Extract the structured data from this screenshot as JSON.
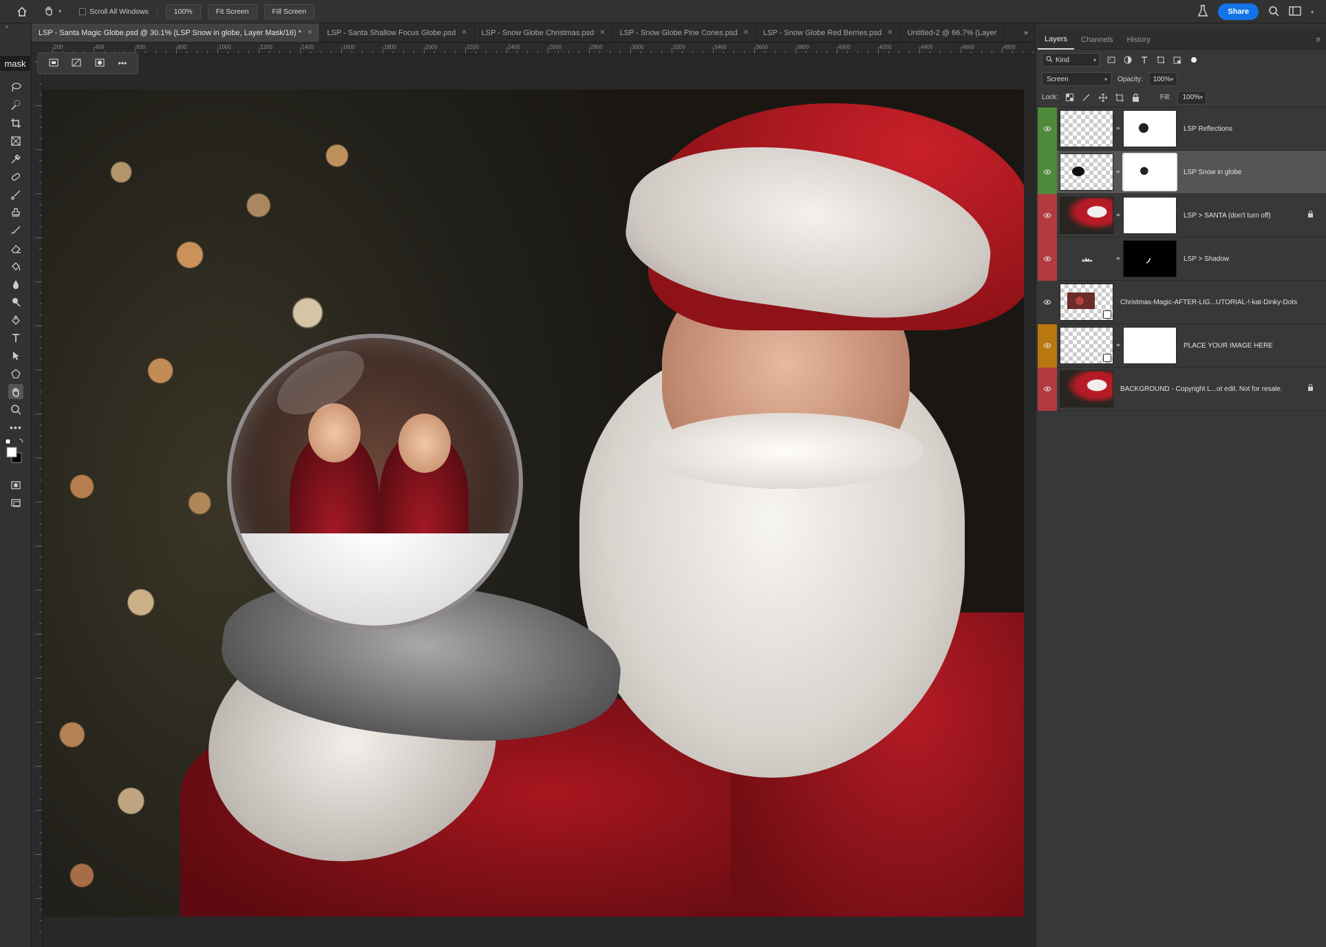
{
  "options_bar": {
    "scroll_all_windows": "Scroll All Windows",
    "zoom_value": "100%",
    "fit_screen": "Fit Screen",
    "fill_screen": "Fill Screen",
    "share": "Share"
  },
  "toolbar": {
    "mask_label": "mask"
  },
  "tabs": [
    {
      "label": "LSP - Santa Magic Globe.psd @ 30.1% (LSP Snow in globe, Layer Mask/16) *",
      "active": true
    },
    {
      "label": "LSP - Santa Shallow Focus Globe.psd",
      "active": false
    },
    {
      "label": "LSP - Snow Globe Christmas.psd",
      "active": false
    },
    {
      "label": "LSP - Snow Globe Pine Cones.psd",
      "active": false
    },
    {
      "label": "LSP - Snow Globe Red Berries.psd",
      "active": false
    },
    {
      "label": "Untitled-2 @ 66.7% (Layer",
      "active": false
    }
  ],
  "ruler_labels": [
    "200",
    "400",
    "600",
    "800",
    "1000",
    "1200",
    "1400",
    "1600",
    "1800",
    "2000",
    "2200",
    "2400",
    "2600",
    "2800",
    "3000",
    "3200",
    "3400",
    "3600",
    "3800",
    "4000",
    "4200",
    "4400",
    "4600",
    "4800"
  ],
  "panel": {
    "tabs": [
      "Layers",
      "Channels",
      "History"
    ],
    "kind_label": "Kind",
    "blend_mode": "Screen",
    "opacity_label": "Opacity:",
    "opacity_value": "100%",
    "lock_label": "Lock:",
    "fill_label": "Fill:",
    "fill_value": "100%"
  },
  "layers": [
    {
      "name": "LSP Reflections",
      "color": "#4f8a3a",
      "selected": false,
      "locked": false
    },
    {
      "name": "LSP Snow in globe",
      "color": "#4f8a3a",
      "selected": true,
      "locked": false
    },
    {
      "name": "LSP > SANTA (don't turn off)",
      "color": "#b23a3f",
      "selected": false,
      "locked": true
    },
    {
      "name": "LSP > Shadow",
      "color": "#b23a3f",
      "selected": false,
      "locked": false
    },
    {
      "name": "Christmas-Magic-AFTER-LIG...UTORIAL-!-kat-Dinky-Dots",
      "color": "none",
      "selected": false,
      "locked": false
    },
    {
      "name": "PLACE YOUR IMAGE HERE",
      "color": "#b8770f",
      "selected": false,
      "locked": false
    },
    {
      "name": "BACKGROUND - Copyright L...ot edit. Not for resale.",
      "color": "#b23a3f",
      "selected": false,
      "locked": true
    }
  ]
}
